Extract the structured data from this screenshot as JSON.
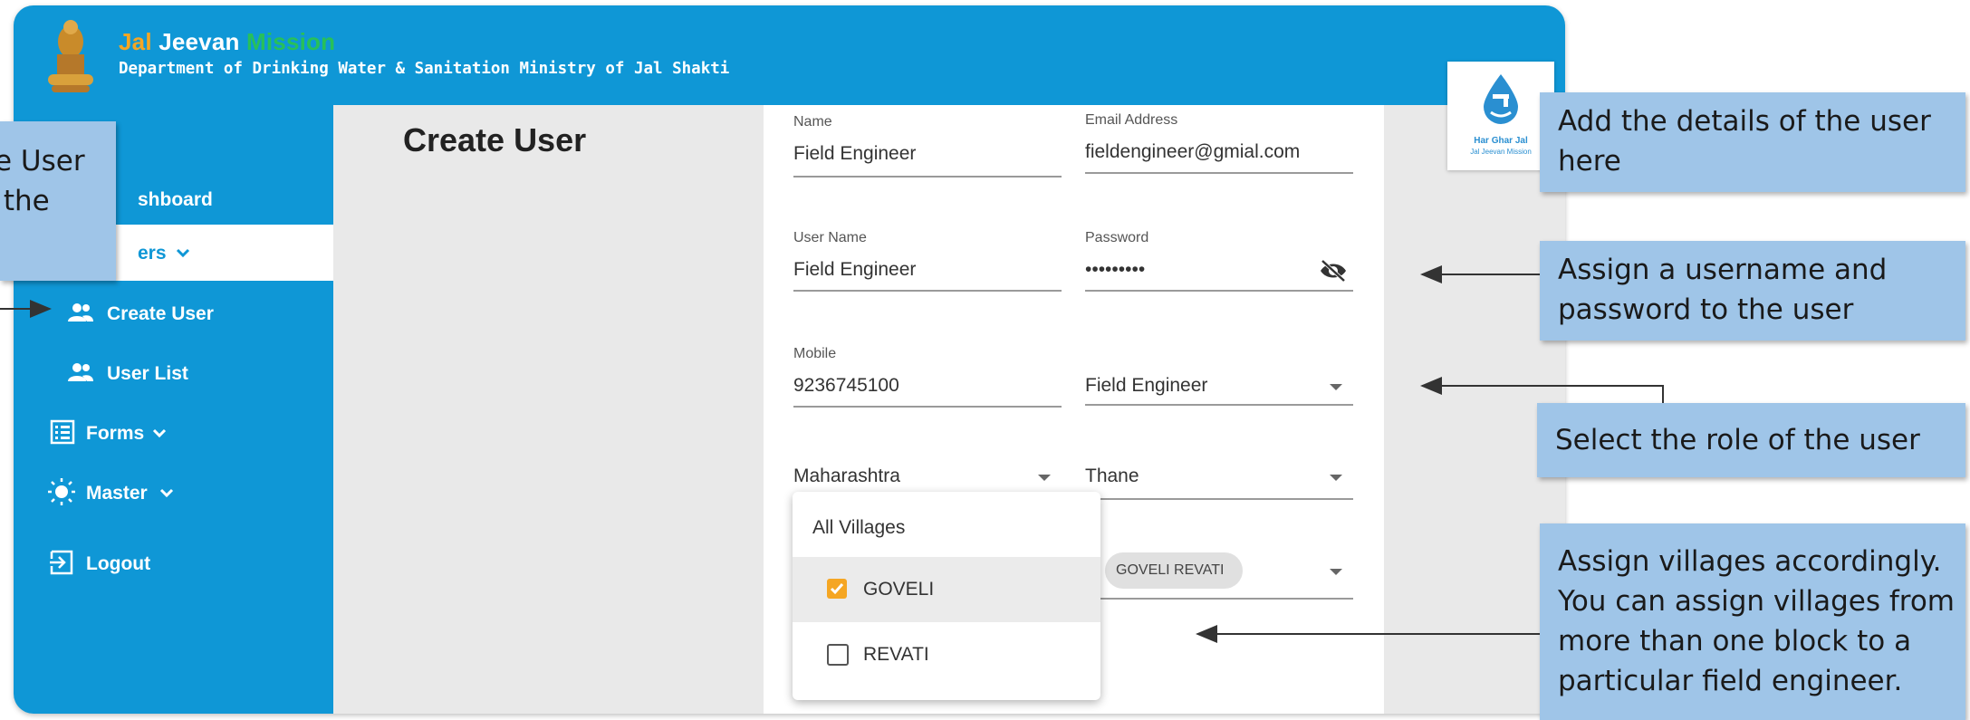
{
  "header": {
    "brand_part1": "Jal",
    "brand_part2": "Jeevan",
    "brand_part3": "Mission",
    "department": "Department of Drinking Water & Sanitation Ministry of Jal Shakti"
  },
  "sidebar": {
    "items": [
      {
        "label": "shboard"
      },
      {
        "label": "ers"
      },
      {
        "label": "Create User"
      },
      {
        "label": "User List"
      },
      {
        "label": "Forms"
      },
      {
        "label": "Master"
      },
      {
        "label": "Logout"
      }
    ]
  },
  "page": {
    "title": "Create User"
  },
  "form": {
    "name": {
      "label": "Name",
      "value": "Field Engineer"
    },
    "email": {
      "label": "Email Address",
      "value": "fieldengineer@gmial.com"
    },
    "username": {
      "label": "User Name",
      "value": "Field Engineer"
    },
    "password": {
      "label": "Password",
      "value": "•••••••••"
    },
    "mobile": {
      "label": "Mobile",
      "value": "9236745100"
    },
    "role": {
      "value": "Field Engineer"
    },
    "state": {
      "value": "Maharashtra"
    },
    "district": {
      "value": "Thane"
    },
    "village_chip": "GOVELI REVATI"
  },
  "village_dropdown": {
    "all_label": "All Villages",
    "options": [
      {
        "label": "GOVELI",
        "checked": true
      },
      {
        "label": "REVATI",
        "checked": false
      }
    ]
  },
  "logo": {
    "line1": "Har Ghar Jal",
    "line2": "Jal Jeevan Mission"
  },
  "callouts": {
    "left_line1": "e User",
    "left_line2": " the",
    "details_line1": "Add the details of the user",
    "details_line2": "here",
    "credentials_line1": "Assign a username and",
    "credentials_line2": "password to the user",
    "role": "Select the role of the user",
    "villages_line1": "Assign villages accordingly.",
    "villages_line2": "You can assign villages from",
    "villages_line3": "more than one block to a",
    "villages_line4": "particular field engineer."
  },
  "colors": {
    "primary": "#0f97d6",
    "callout": "#9fc5e8",
    "accent_check": "#f5a623",
    "brand_orange": "#f5a623",
    "brand_green": "#27c05a"
  },
  "icons": [
    "emblem-icon",
    "users-icon",
    "forms-icon",
    "master-icon",
    "logout-icon",
    "chevron-down-icon",
    "eye-off-icon",
    "water-drop-icon",
    "checkbox-icon"
  ]
}
